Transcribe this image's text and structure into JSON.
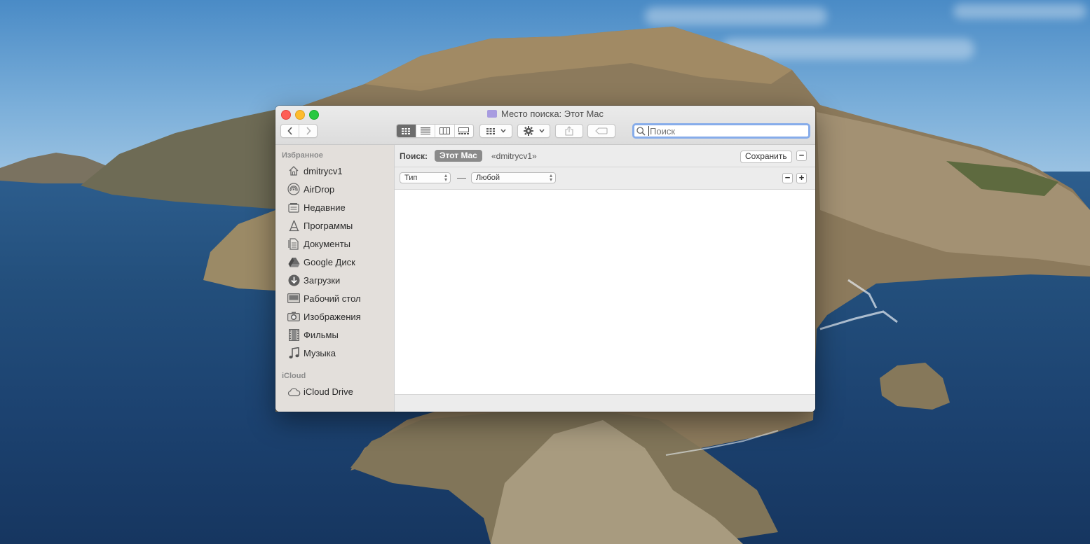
{
  "window": {
    "title": "Место поиска: Этот Mac"
  },
  "toolbar": {
    "back": "back",
    "forward": "forward",
    "search_placeholder": "Поиск"
  },
  "sidebar": {
    "favorites_title": "Избранное",
    "favorites": [
      {
        "label": "dmitrycv1",
        "icon": "home-icon"
      },
      {
        "label": "AirDrop",
        "icon": "airdrop-icon"
      },
      {
        "label": "Недавние",
        "icon": "recents-icon"
      },
      {
        "label": "Программы",
        "icon": "applications-icon"
      },
      {
        "label": "Документы",
        "icon": "documents-icon"
      },
      {
        "label": "Google Диск",
        "icon": "google-drive-icon"
      },
      {
        "label": "Загрузки",
        "icon": "downloads-icon"
      },
      {
        "label": "Рабочий стол",
        "icon": "desktop-icon"
      },
      {
        "label": "Изображения",
        "icon": "camera-icon"
      },
      {
        "label": "Фильмы",
        "icon": "film-icon"
      },
      {
        "label": "Музыка",
        "icon": "music-icon"
      }
    ],
    "icloud_title": "iCloud",
    "icloud": [
      {
        "label": "iCloud Drive",
        "icon": "cloud-icon"
      }
    ]
  },
  "search_scope": {
    "label": "Поиск:",
    "active": "Этот Mac",
    "other": "«dmitrycv1»",
    "save": "Сохранить",
    "minus": "−"
  },
  "criteria": {
    "attribute": "Тип",
    "dash": "—",
    "value": "Любой",
    "minus": "−",
    "plus": "+"
  }
}
